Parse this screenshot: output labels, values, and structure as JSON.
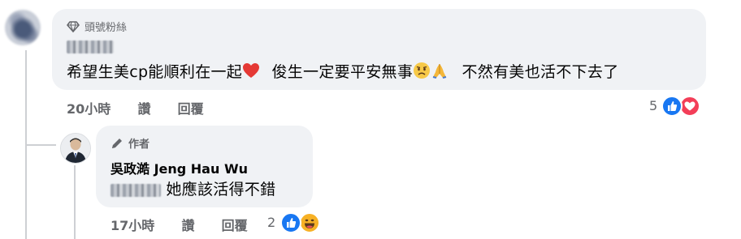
{
  "comment1": {
    "badge": "頭號粉絲",
    "text_part1": "希望生美cp能順利在一起",
    "text_part2": "俊生一定要平安無事",
    "text_part3": "不然有美也活不下去了",
    "time": "20小時",
    "like_label": "讚",
    "reply_label": "回覆",
    "reaction_count": "5",
    "reactions": [
      "like-icon",
      "love-icon"
    ]
  },
  "reply1": {
    "badge": "作者",
    "author": "吳政澔 Jeng Hau Wu",
    "text": "她應該活得不錯",
    "time": "17小時",
    "like_label": "讚",
    "reply_label": "回覆",
    "reaction_count": "2",
    "reactions": [
      "like-icon",
      "haha-icon"
    ]
  },
  "colors": {
    "bubble_bg": "#f0f2f5",
    "meta_text": "#65676b",
    "like_blue": "#1877f2",
    "love_red": "#f33e58",
    "haha_yellow": "#f7b125"
  }
}
